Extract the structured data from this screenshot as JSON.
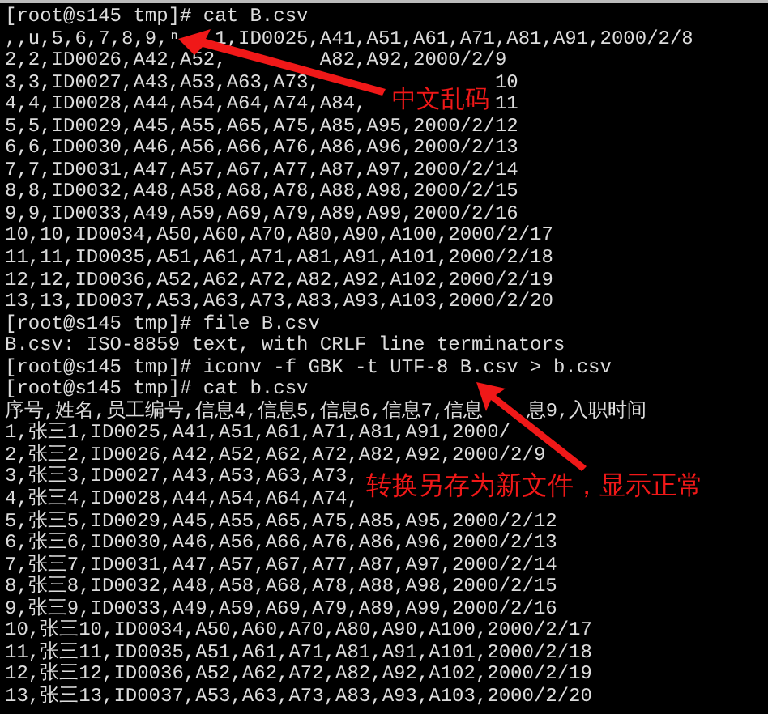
{
  "terminal": {
    "lines": [
      {
        "text": "[root@s145 tmp]# cat B.csv"
      },
      {
        "text": ",,u,5,6,7,8,9,ⁿ   1,ID0025,A41,A51,A61,A71,A81,A91,2000/2/8"
      },
      {
        "parts": [
          "2,2,ID0026,A42,A52,",
          "A82,A92,2000/2/9"
        ]
      },
      {
        "parts": [
          "3,3,ID0027,A43,A53,A63,A73,",
          "10"
        ]
      },
      {
        "parts": [
          "4,4,ID0028,A44,A54,A64,A74,A84,",
          "11"
        ]
      },
      {
        "text": "5,5,ID0029,A45,A55,A65,A75,A85,A95,2000/2/12"
      },
      {
        "text": "6,6,ID0030,A46,A56,A66,A76,A86,A96,2000/2/13"
      },
      {
        "text": "7,7,ID0031,A47,A57,A67,A77,A87,A97,2000/2/14"
      },
      {
        "text": "8,8,ID0032,A48,A58,A68,A78,A88,A98,2000/2/15"
      },
      {
        "text": "9,9,ID0033,A49,A59,A69,A79,A89,A99,2000/2/16"
      },
      {
        "text": "10,10,ID0034,A50,A60,A70,A80,A90,A100,2000/2/17"
      },
      {
        "text": "11,11,ID0035,A51,A61,A71,A81,A91,A101,2000/2/18"
      },
      {
        "text": "12,12,ID0036,A52,A62,A72,A82,A92,A102,2000/2/19"
      },
      {
        "text": "13,13,ID0037,A53,A63,A73,A83,A93,A103,2000/2/20"
      },
      {
        "text": "[root@s145 tmp]# file B.csv"
      },
      {
        "text": "B.csv: ISO-8859 text, with CRLF line terminators"
      },
      {
        "text": "[root@s145 tmp]# iconv -f GBK -t UTF-8 B.csv > b.csv"
      },
      {
        "text": "[root@s145 tmp]# cat b.csv"
      },
      {
        "parts": [
          "序号,姓名,员工编号,信息4,信息5,信息6,信息7,信息",
          "息9,入职时间"
        ]
      },
      {
        "text": "1,张三1,ID0025,A41,A51,A61,A71,A81,A91,2000/"
      },
      {
        "text": "2,张三2,ID0026,A42,A52,A62,A72,A82,A92,2000/2/9"
      },
      {
        "text": "3,张三3,ID0027,A43,A53,A63,A73,"
      },
      {
        "text": "4,张三4,ID0028,A44,A54,A64,A74,"
      },
      {
        "text": "5,张三5,ID0029,A45,A55,A65,A75,A85,A95,2000/2/12"
      },
      {
        "text": "6,张三6,ID0030,A46,A56,A66,A76,A86,A96,2000/2/13"
      },
      {
        "text": "7,张三7,ID0031,A47,A57,A67,A77,A87,A97,2000/2/14"
      },
      {
        "text": "8,张三8,ID0032,A48,A58,A68,A78,A88,A98,2000/2/15"
      },
      {
        "text": "9,张三9,ID0033,A49,A59,A69,A79,A89,A99,2000/2/16"
      },
      {
        "text": "10,张三10,ID0034,A50,A60,A70,A80,A90,A100,2000/2/17"
      },
      {
        "text": "11,张三11,ID0035,A51,A61,A71,A81,A91,A101,2000/2/18"
      },
      {
        "text": "12,张三12,ID0036,A52,A62,A72,A82,A92,A102,2000/2/19"
      },
      {
        "text": "13,张三13,ID0037,A53,A63,A73,A83,A93,A103,2000/2/20"
      }
    ]
  },
  "annotations": [
    {
      "text": "中文乱码"
    },
    {
      "text": "转换另存为新文件，显示正常"
    }
  ]
}
